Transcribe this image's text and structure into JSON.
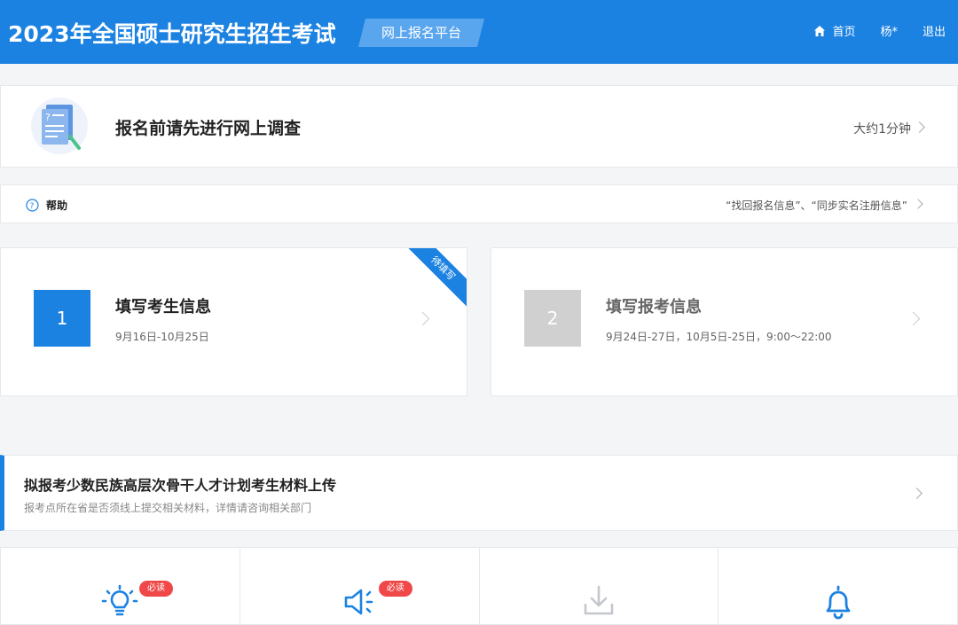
{
  "header": {
    "brand": "2023年全国硕士研究生招生考试",
    "platform": "网上报名平台",
    "nav": {
      "home": "首页",
      "user": "杨*",
      "logout": "退出"
    },
    "home_icon": "home-icon",
    "color": "#1b82e2"
  },
  "survey": {
    "title": "报名前请先进行网上调查",
    "time": "大约1分钟",
    "icon": "questionnaire-icon"
  },
  "help": {
    "label": "帮助",
    "links": "“找回报名信息”、“同步实名注册信息”",
    "icon": "help-circle-icon"
  },
  "steps": [
    {
      "number": "1",
      "title": "填写考生信息",
      "date": "9月16日-10月25日",
      "badge": "待填写",
      "active": true
    },
    {
      "number": "2",
      "title": "填写报考信息",
      "date": "9月24日-27日，10月5日-25日，9:00～22:00",
      "active": false
    }
  ],
  "minority": {
    "title": "拟报考少数民族高层次骨干人才计划考生材料上传",
    "subtitle": "报考点所在省是否须线上提交相关材料，详情请咨询相关部门"
  },
  "tiles": [
    {
      "icon": "lightbulb-icon",
      "badge": "必读"
    },
    {
      "icon": "megaphone-icon",
      "badge": "必读"
    },
    {
      "icon": "download-icon"
    },
    {
      "icon": "bell-icon"
    }
  ],
  "colors": {
    "accent": "#1b82e2",
    "badge": "#f04848",
    "disabled": "#d0d0d0"
  }
}
